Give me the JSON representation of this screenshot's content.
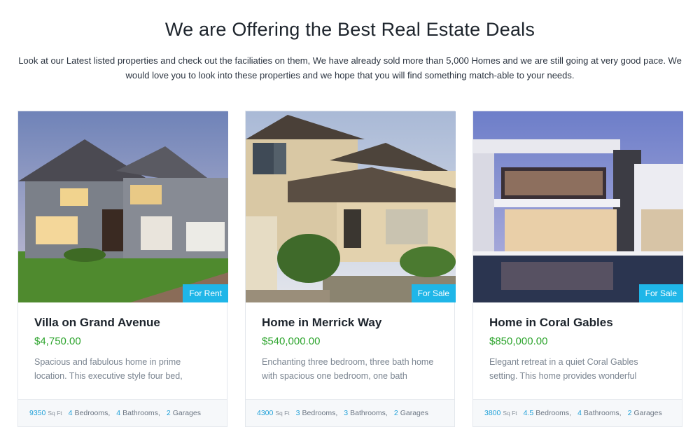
{
  "page": {
    "title": "We are Offering the Best Real Estate Deals",
    "intro": "Look at our Latest listed properties and check out the faciliaties on them, We have already sold more than 5,000 Homes and we are still going at very good pace. We would love you to look into these properties and we hope that you will find something match-able to your needs."
  },
  "colors": {
    "accent": "#1fb6e8",
    "price": "#2fa52f",
    "meta_number": "#1fa0d8"
  },
  "cards": [
    {
      "title": "Villa on Grand Avenue",
      "price": "$4,750.00",
      "badge": "For Rent",
      "description": "Spacious and fabulous home in prime location. This executive style four bed,",
      "sqft": "9350",
      "sqft_unit": "Sq Ft",
      "bedrooms_num": "4",
      "bedrooms_label": "Bedrooms,",
      "bathrooms_num": "4",
      "bathrooms_label": "Bathrooms,",
      "garages_num": "2",
      "garages_label": "Garages"
    },
    {
      "title": "Home in Merrick Way",
      "price": "$540,000.00",
      "badge": "For Sale",
      "description": "Enchanting three bedroom, three bath home with spacious one bedroom, one bath",
      "sqft": "4300",
      "sqft_unit": "Sq Ft",
      "bedrooms_num": "3",
      "bedrooms_label": "Bedrooms,",
      "bathrooms_num": "3",
      "bathrooms_label": "Bathrooms,",
      "garages_num": "2",
      "garages_label": "Garages"
    },
    {
      "title": "Home in Coral Gables",
      "price": "$850,000.00",
      "badge": "For Sale",
      "description": "Elegant retreat in a quiet Coral Gables setting. This home provides wonderful",
      "sqft": "3800",
      "sqft_unit": "Sq Ft",
      "bedrooms_num": "4.5",
      "bedrooms_label": "Bedrooms,",
      "bathrooms_num": "4",
      "bathrooms_label": "Bathrooms,",
      "garages_num": "2",
      "garages_label": "Garages"
    }
  ]
}
